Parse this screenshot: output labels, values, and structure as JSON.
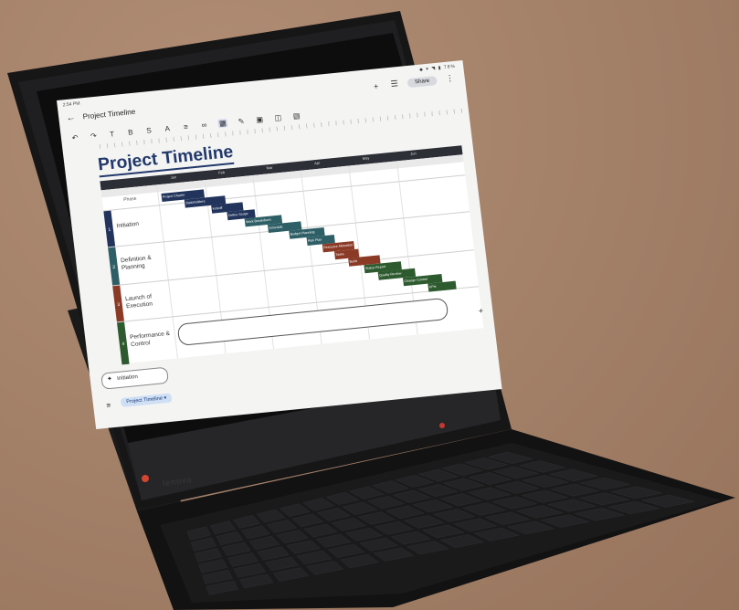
{
  "screen": {
    "status_time": "2:54 PM",
    "status_icons": "◆ ▾ ◥ ▮ 78%",
    "title": "Project Timeline",
    "share_label": "Share",
    "heading": "Project Timeline",
    "phase_header": "Phase",
    "months": [
      "Jan",
      "Feb",
      "Mar",
      "Apr",
      "May",
      "Jun"
    ],
    "phases": [
      {
        "num": "1",
        "label": "Initiation",
        "color": "#22345c"
      },
      {
        "num": "2",
        "label": "Definition & Planning",
        "color": "#2f5f66"
      },
      {
        "num": "3",
        "label": "Launch of Execution",
        "color": "#8b3a26"
      },
      {
        "num": "4",
        "label": "Performance & Control",
        "color": "#2d5a2e"
      }
    ],
    "bars": [
      {
        "text": "Project Charter",
        "color": "#22345c"
      },
      {
        "text": "Stakeholders",
        "color": "#22345c"
      },
      {
        "text": "Kickoff",
        "color": "#22345c"
      },
      {
        "text": "Define Scope",
        "color": "#22345c"
      },
      {
        "text": "Work Breakdown",
        "color": "#2f5f66"
      },
      {
        "text": "Schedule",
        "color": "#2f5f66"
      },
      {
        "text": "Budget Planning",
        "color": "#2f5f66"
      },
      {
        "text": "Risk Plan",
        "color": "#2f5f66"
      },
      {
        "text": "Resource Allocation",
        "color": "#8b3a26"
      },
      {
        "text": "Tasks",
        "color": "#8b3a26"
      },
      {
        "text": "Build",
        "color": "#8b3a26"
      },
      {
        "text": "Status Report",
        "color": "#2d5a2e"
      },
      {
        "text": "Quality Review",
        "color": "#2d5a2e"
      },
      {
        "text": "Change Control",
        "color": "#2d5a2e"
      },
      {
        "text": "KPIs",
        "color": "#2d5a2e"
      }
    ],
    "chat_text": "Initiation",
    "sheet_tab": "Project Timeline ▾"
  },
  "device": {
    "brand": "lenovo"
  },
  "colors": {
    "background": "#a27f67",
    "tablet_body": "#1b1b1d",
    "keyboard": "#151516",
    "accent": "#22396b"
  }
}
